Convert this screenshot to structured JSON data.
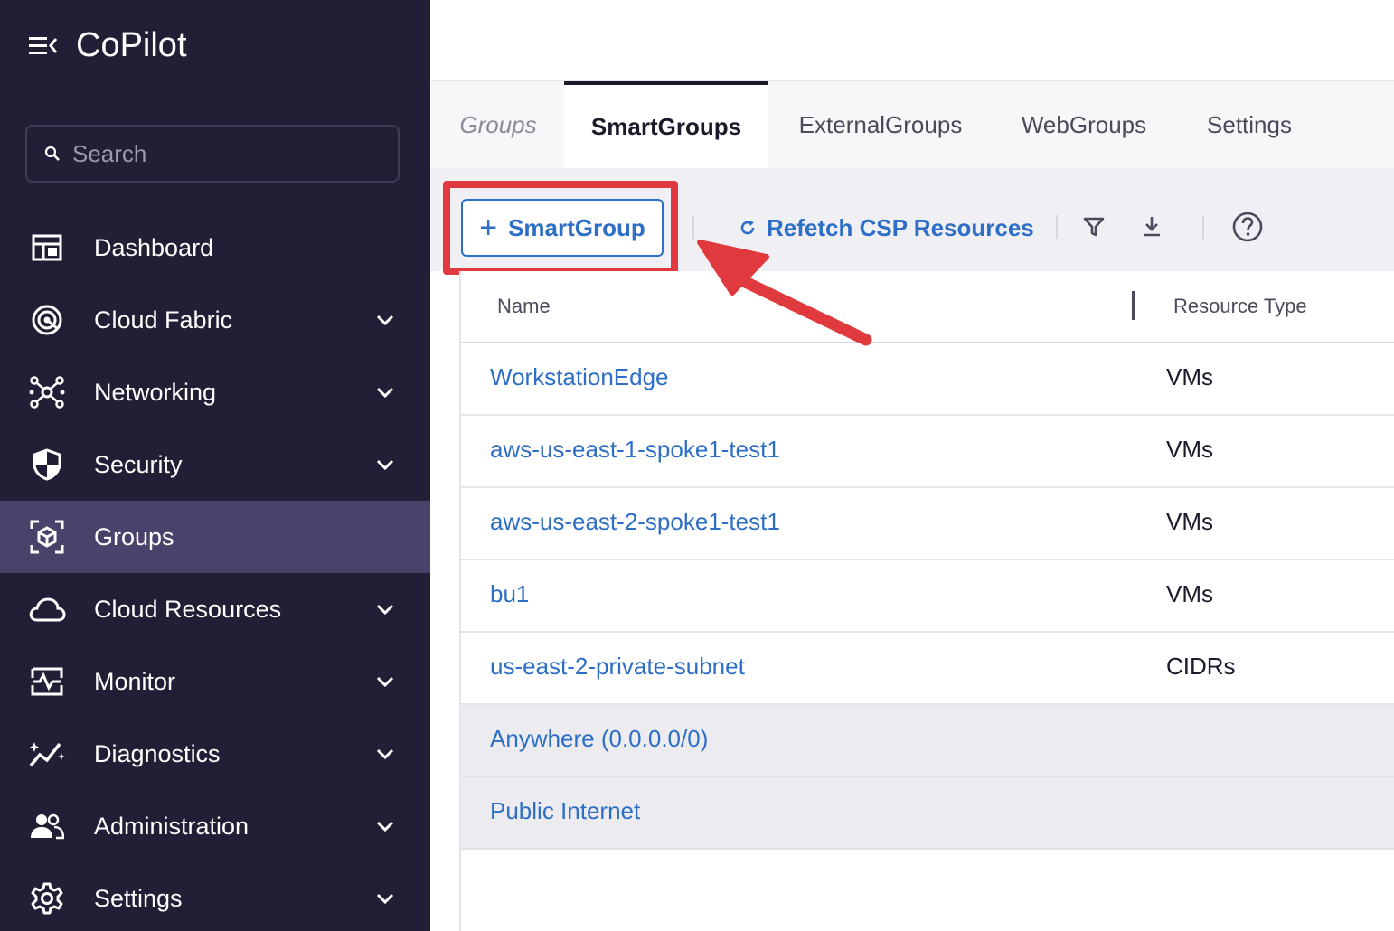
{
  "sidebar": {
    "brand": "CoPilot",
    "search_placeholder": "Search",
    "items": [
      {
        "label": "Dashboard",
        "icon": "dashboard-icon",
        "expandable": false,
        "active": false
      },
      {
        "label": "Cloud Fabric",
        "icon": "cloud-fabric-icon",
        "expandable": true,
        "active": false
      },
      {
        "label": "Networking",
        "icon": "networking-icon",
        "expandable": true,
        "active": false
      },
      {
        "label": "Security",
        "icon": "shield-icon",
        "expandable": true,
        "active": false
      },
      {
        "label": "Groups",
        "icon": "groups-icon",
        "expandable": false,
        "active": true
      },
      {
        "label": "Cloud Resources",
        "icon": "cloud-icon",
        "expandable": true,
        "active": false
      },
      {
        "label": "Monitor",
        "icon": "monitor-icon",
        "expandable": true,
        "active": false
      },
      {
        "label": "Diagnostics",
        "icon": "diagnostics-icon",
        "expandable": true,
        "active": false
      },
      {
        "label": "Administration",
        "icon": "users-icon",
        "expandable": true,
        "active": false
      },
      {
        "label": "Settings",
        "icon": "gear-icon",
        "expandable": true,
        "active": false
      }
    ]
  },
  "tabs": [
    {
      "label": "Groups"
    },
    {
      "label": "SmartGroups"
    },
    {
      "label": "ExternalGroups"
    },
    {
      "label": "WebGroups"
    },
    {
      "label": "Settings"
    }
  ],
  "toolbar": {
    "add_label": "SmartGroup",
    "add_plus": "+",
    "refetch_label": "Refetch CSP Resources"
  },
  "table": {
    "columns": [
      "Name",
      "Resource Type"
    ],
    "rows": [
      {
        "name": "WorkstationEdge",
        "type": "VMs"
      },
      {
        "name": "aws-us-east-1-spoke1-test1",
        "type": "VMs"
      },
      {
        "name": "aws-us-east-2-spoke1-test1",
        "type": "VMs"
      },
      {
        "name": "bu1",
        "type": "VMs"
      },
      {
        "name": "us-east-2-private-subnet",
        "type": "CIDRs"
      },
      {
        "name": "Anywhere (0.0.0.0/0)",
        "type": ""
      },
      {
        "name": "Public Internet",
        "type": ""
      }
    ]
  },
  "colors": {
    "sidebar_bg": "#211f35",
    "active_bg": "#4a426a",
    "accent_blue": "#2d6ec6",
    "annotation_red": "#e0393e"
  }
}
